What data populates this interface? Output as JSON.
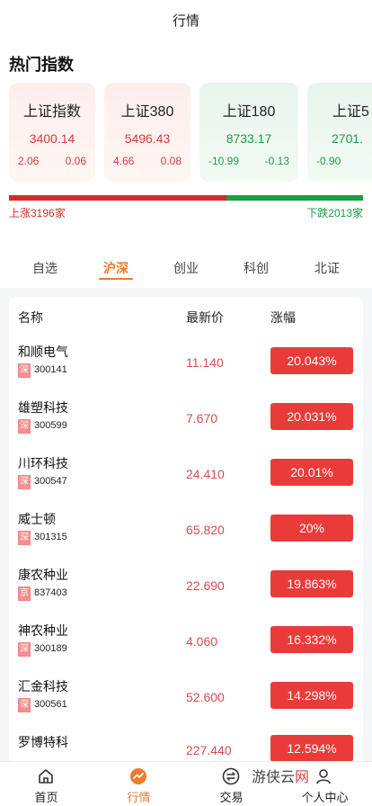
{
  "header": {
    "title": "行情"
  },
  "hot": {
    "title": "热门指数",
    "cards": [
      {
        "name": "上证指数",
        "value": "3400.14",
        "change": "2.06",
        "pct": "0.06",
        "trend": "up"
      },
      {
        "name": "上证380",
        "value": "5496.43",
        "change": "4.66",
        "pct": "0.08",
        "trend": "up"
      },
      {
        "name": "上证180",
        "value": "8733.17",
        "change": "-10.99",
        "pct": "-0.13",
        "trend": "down"
      },
      {
        "name": "上证5",
        "value": "2701.",
        "change": "-0.90",
        "pct": "",
        "trend": "down"
      }
    ]
  },
  "breadth": {
    "up_label": "上涨3196家",
    "down_label": "下跌2013家",
    "up_count": 3196,
    "down_count": 2013,
    "up_color": "#d42a2a",
    "down_color": "#1c9a46"
  },
  "tabs": [
    {
      "label": "自选"
    },
    {
      "label": "沪深",
      "active": true
    },
    {
      "label": "创业"
    },
    {
      "label": "科创"
    },
    {
      "label": "北证"
    }
  ],
  "list": {
    "headers": {
      "name": "名称",
      "price": "最新价",
      "change": "涨幅"
    },
    "rows": [
      {
        "name": "和顺电气",
        "market": "深",
        "code": "300141",
        "price": "11.140",
        "pct": "20.043%"
      },
      {
        "name": "雄塑科技",
        "market": "深",
        "code": "300599",
        "price": "7.670",
        "pct": "20.031%"
      },
      {
        "name": "川环科技",
        "market": "深",
        "code": "300547",
        "price": "24.410",
        "pct": "20.01%"
      },
      {
        "name": "威士顿",
        "market": "深",
        "code": "301315",
        "price": "65.820",
        "pct": "20%"
      },
      {
        "name": "康农种业",
        "market": "京",
        "code": "837403",
        "price": "22.690",
        "pct": "19.863%"
      },
      {
        "name": "神农种业",
        "market": "深",
        "code": "300189",
        "price": "4.060",
        "pct": "16.332%"
      },
      {
        "name": "汇金科技",
        "market": "深",
        "code": "300561",
        "price": "52.600",
        "pct": "14.298%"
      },
      {
        "name": "罗博特科",
        "market": "深",
        "code": "",
        "price": "227.440",
        "pct": "12.594%"
      }
    ]
  },
  "tabbar": [
    {
      "label": "首页",
      "icon": "home-icon"
    },
    {
      "label": "行情",
      "icon": "market-icon",
      "active": true
    },
    {
      "label": "交易",
      "icon": "trade-icon"
    },
    {
      "label": "个人中心",
      "icon": "profile-icon"
    }
  ],
  "watermark": {
    "text": "游侠云",
    "net": "网"
  },
  "colors": {
    "accent": "#ee7a2b",
    "up": "#d13b3b",
    "down": "#1f9a47",
    "badge": "#ea3b3b"
  }
}
